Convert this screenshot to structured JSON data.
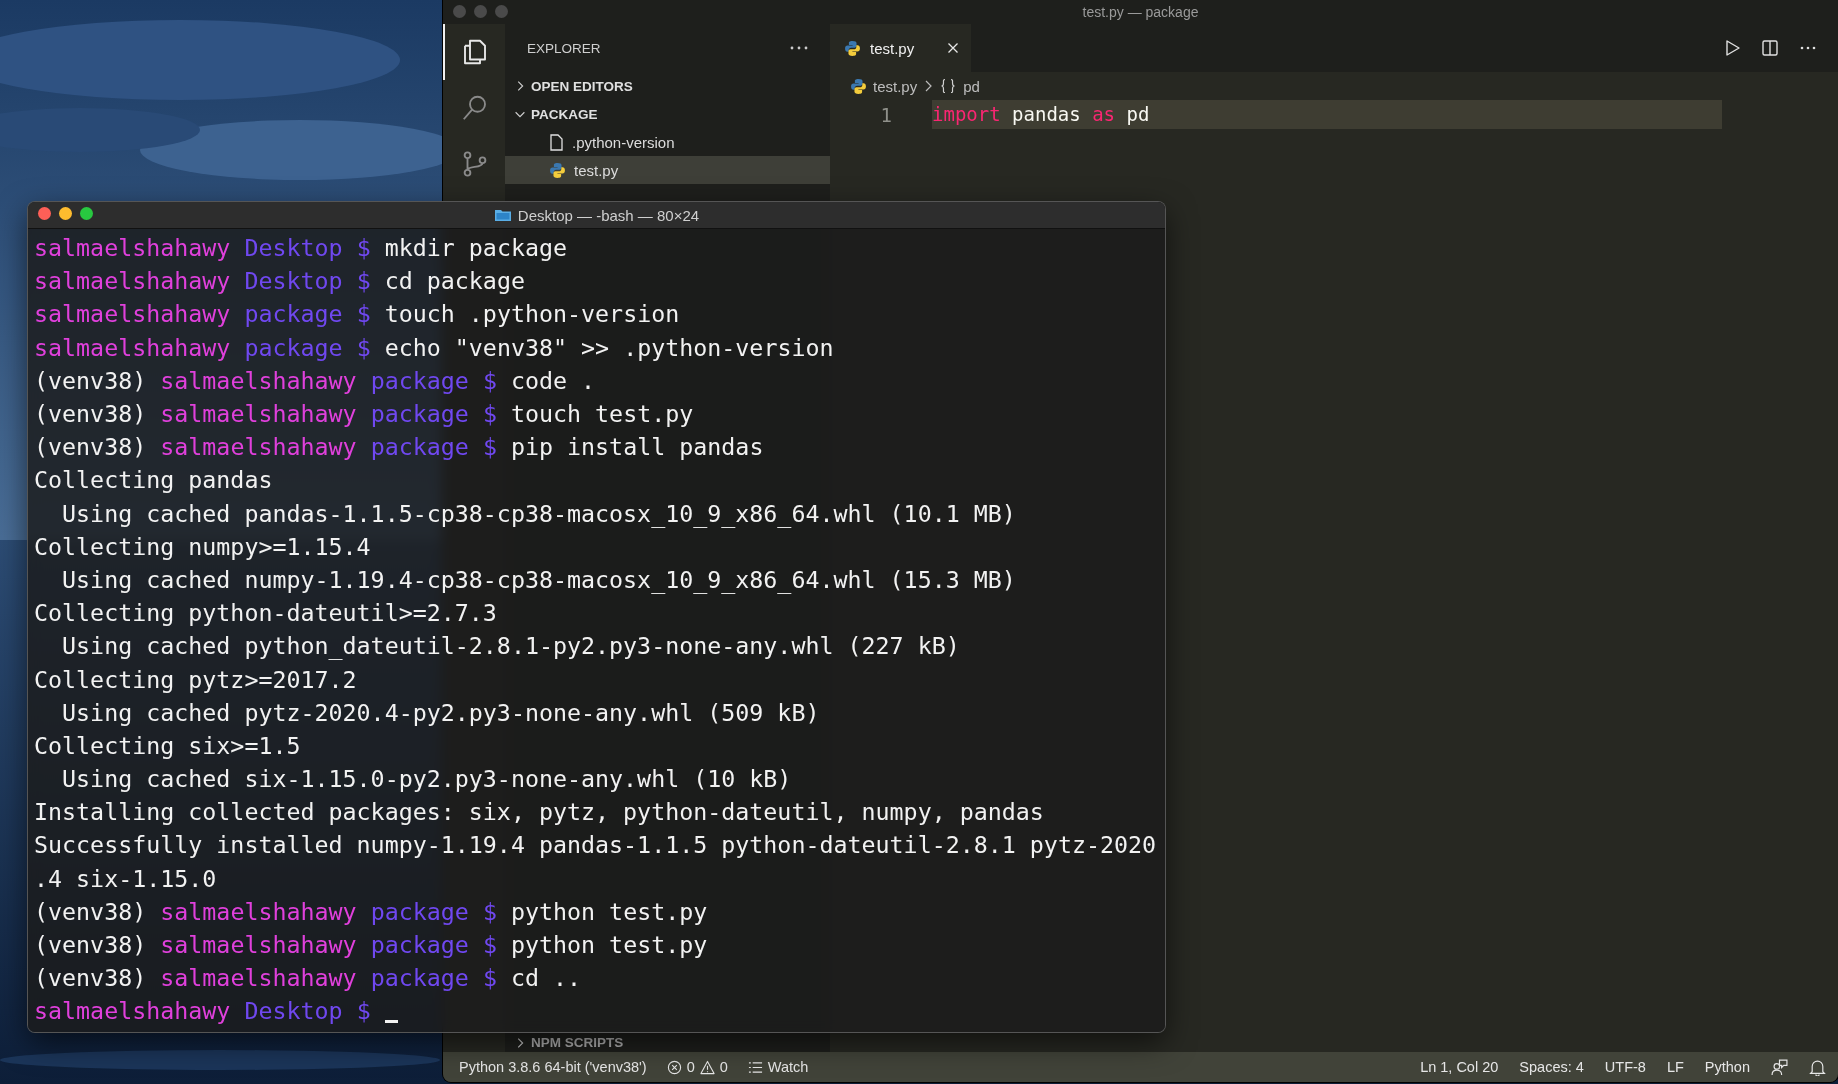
{
  "vscode": {
    "title": "test.py — package",
    "active": false,
    "activity_bar": [
      {
        "kind": "files",
        "selected": true
      },
      {
        "kind": "search",
        "selected": false
      },
      {
        "kind": "source-control",
        "selected": false
      }
    ],
    "sidebar": {
      "title": "EXPLORER",
      "sections": [
        {
          "label": "OPEN EDITORS",
          "expanded": false
        },
        {
          "label": "PACKAGE",
          "expanded": true,
          "children": [
            {
              "label": ".python-version",
              "kind": "file",
              "selected": false
            },
            {
              "label": "test.py",
              "kind": "python",
              "selected": true
            }
          ]
        }
      ],
      "bottom_sections": [
        {
          "label": "NPM SCRIPTS",
          "expanded": false
        }
      ]
    },
    "editor": {
      "tabs": [
        {
          "label": "test.py",
          "kind": "python",
          "selected": true
        }
      ],
      "breadcrumb": [
        {
          "label": "test.py",
          "kind": "python"
        },
        {
          "label": "pd",
          "kind": "namespace"
        }
      ],
      "lines": [
        {
          "number": "1",
          "current": true,
          "tokens": [
            {
              "text": "import",
              "kind": "keyword"
            },
            {
              "text": " pandas ",
              "kind": "plain"
            },
            {
              "text": "as",
              "kind": "keyword"
            },
            {
              "text": " pd",
              "kind": "plain"
            }
          ]
        }
      ]
    },
    "status_bar": {
      "left": [
        {
          "kind": "text",
          "text": "Python 3.8.6 64-bit ('venv38')"
        },
        {
          "kind": "problems",
          "errors": "0",
          "warnings": "0"
        },
        {
          "kind": "watch",
          "text": "Watch"
        }
      ],
      "right": [
        {
          "kind": "text",
          "text": "Ln 1, Col 20"
        },
        {
          "kind": "text",
          "text": "Spaces: 4"
        },
        {
          "kind": "text",
          "text": "UTF-8"
        },
        {
          "kind": "text",
          "text": "LF"
        },
        {
          "kind": "text",
          "text": "Python"
        },
        {
          "kind": "feedback"
        },
        {
          "kind": "bell"
        }
      ]
    }
  },
  "terminal": {
    "title": "Desktop — -bash — 80×24",
    "active": true,
    "lines": [
      {
        "kind": "prompt",
        "user": "salmaelshahawy",
        "dir": "Desktop",
        "sign": "$",
        "command": "mkdir package"
      },
      {
        "kind": "prompt",
        "user": "salmaelshahawy",
        "dir": "Desktop",
        "sign": "$",
        "command": "cd package"
      },
      {
        "kind": "prompt",
        "user": "salmaelshahawy",
        "dir": "package",
        "sign": "$",
        "command": "touch .python-version"
      },
      {
        "kind": "prompt",
        "user": "salmaelshahawy",
        "dir": "package",
        "sign": "$",
        "command": "echo \"venv38\" >> .python-version"
      },
      {
        "kind": "prompt",
        "venv": "(venv38)",
        "user": "salmaelshahawy",
        "dir": "package",
        "sign": "$",
        "command": "code ."
      },
      {
        "kind": "prompt",
        "venv": "(venv38)",
        "user": "salmaelshahawy",
        "dir": "package",
        "sign": "$",
        "command": "touch test.py"
      },
      {
        "kind": "prompt",
        "venv": "(venv38)",
        "user": "salmaelshahawy",
        "dir": "package",
        "sign": "$",
        "command": "pip install pandas"
      },
      {
        "kind": "output",
        "text": "Collecting pandas"
      },
      {
        "kind": "output",
        "text": "  Using cached pandas-1.1.5-cp38-cp38-macosx_10_9_x86_64.whl (10.1 MB)"
      },
      {
        "kind": "output",
        "text": "Collecting numpy>=1.15.4"
      },
      {
        "kind": "output",
        "text": "  Using cached numpy-1.19.4-cp38-cp38-macosx_10_9_x86_64.whl (15.3 MB)"
      },
      {
        "kind": "output",
        "text": "Collecting python-dateutil>=2.7.3"
      },
      {
        "kind": "output",
        "text": "  Using cached python_dateutil-2.8.1-py2.py3-none-any.whl (227 kB)"
      },
      {
        "kind": "output",
        "text": "Collecting pytz>=2017.2"
      },
      {
        "kind": "output",
        "text": "  Using cached pytz-2020.4-py2.py3-none-any.whl (509 kB)"
      },
      {
        "kind": "output",
        "text": "Collecting six>=1.5"
      },
      {
        "kind": "output",
        "text": "  Using cached six-1.15.0-py2.py3-none-any.whl (10 kB)"
      },
      {
        "kind": "output",
        "text": "Installing collected packages: six, pytz, python-dateutil, numpy, pandas"
      },
      {
        "kind": "output",
        "text": "Successfully installed numpy-1.19.4 pandas-1.1.5 python-dateutil-2.8.1 pytz-2020"
      },
      {
        "kind": "output",
        "text": ".4 six-1.15.0"
      },
      {
        "kind": "prompt",
        "venv": "(venv38)",
        "user": "salmaelshahawy",
        "dir": "package",
        "sign": "$",
        "command": "python test.py"
      },
      {
        "kind": "prompt",
        "venv": "(venv38)",
        "user": "salmaelshahawy",
        "dir": "package",
        "sign": "$",
        "command": "python test.py"
      },
      {
        "kind": "prompt",
        "venv": "(venv38)",
        "user": "salmaelshahawy",
        "dir": "package",
        "sign": "$",
        "command": "cd .."
      },
      {
        "kind": "prompt",
        "user": "salmaelshahawy",
        "dir": "Desktop",
        "sign": "$",
        "cursor": true
      }
    ]
  }
}
